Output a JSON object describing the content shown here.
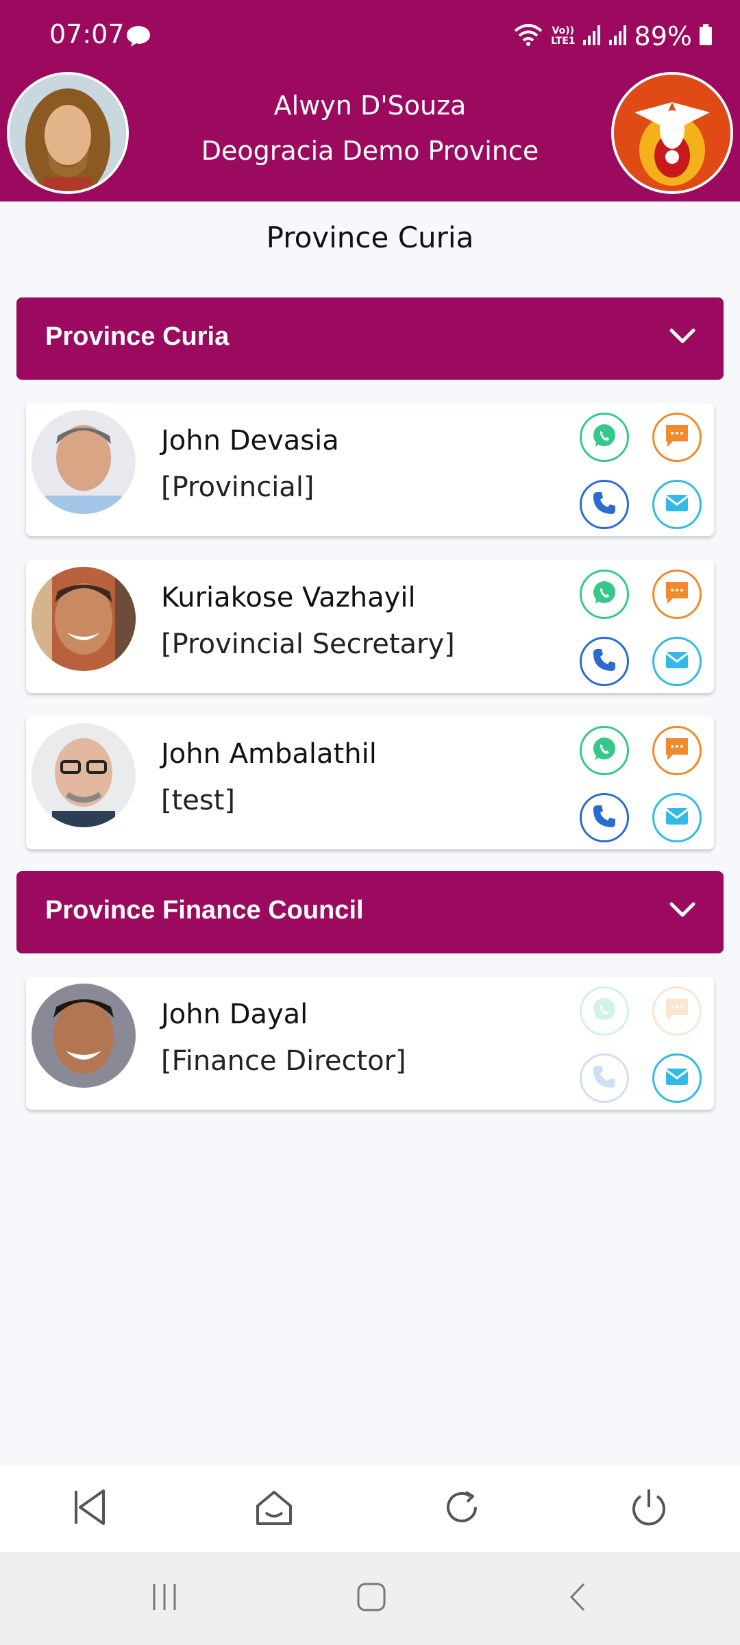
{
  "status_bar": {
    "time": "07:07",
    "network_label_top": "Vo))",
    "network_label_bottom": "LTE1",
    "battery": "89%"
  },
  "header": {
    "user_name": "Alwyn D'Souza",
    "province": "Deogracia Demo Province"
  },
  "page_title": "Province Curia",
  "sections": [
    {
      "title": "Province Curia",
      "members": [
        {
          "name": "John Devasia",
          "role": "[Provincial]"
        },
        {
          "name": "Kuriakose Vazhayil",
          "role": "[Provincial Secretary]"
        },
        {
          "name": "John Ambalathil",
          "role": "[test]"
        }
      ]
    },
    {
      "title": "Province Finance Council",
      "members": [
        {
          "name": "John Dayal",
          "role": "[Finance Director]"
        }
      ]
    }
  ],
  "colors": {
    "brand": "#9c0a5f",
    "whatsapp": "#36c88a",
    "sms": "#f08a2c",
    "call": "#2a6bd0",
    "mail": "#33b9e8"
  },
  "icons": {
    "card_actions": [
      "whatsapp-icon",
      "message-icon",
      "phone-icon",
      "mail-icon"
    ],
    "bottom_nav": [
      "back-icon",
      "home-icon",
      "refresh-icon",
      "power-icon"
    ],
    "system_nav": [
      "recents-icon",
      "home-icon",
      "back-icon"
    ]
  }
}
